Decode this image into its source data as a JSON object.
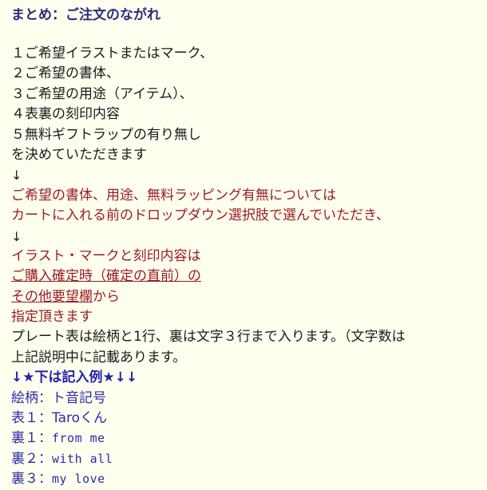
{
  "page": {
    "background_color": "#FFFFF0",
    "title_color": "#2B2B7F",
    "body_text_color": "#1A1A1A",
    "emphasis_color": "#9B1B24",
    "example_color": "#2B2BA8"
  },
  "heading": {
    "text": "まとめ：ご注文のながれ"
  },
  "steps": {
    "item_1": "１ご希望イラストまたはマーク、",
    "item_2": "２ご希望の書体、",
    "item_3": "３ご希望の用途（アイテム）、",
    "item_4": "４表裏の刻印内容",
    "item_5": "５無料ギフトラップの有り無し",
    "closing": "を決めていただきます"
  },
  "arrows": {
    "down_1": "↓",
    "down_2": "↓"
  },
  "emphasis_block_1": {
    "line_1": "ご希望の書体、用途、無料ラッピング有無については",
    "line_2": "カートに入れる前のドロップダウン選択肢で選んでいただき、"
  },
  "emphasis_block_2": {
    "line_1": "イラスト・マークと刻印内容は",
    "line_2_underlined": "ご購入確定時（確定の直前）の",
    "line_3_underlined": "その他要望欄",
    "line_3_tail": "から",
    "line_4": "指定頂きます"
  },
  "notes": {
    "line_1": "プレート表は絵柄と1行、裏は文字３行まで入ります。（文字数は",
    "line_2": "上記説明中に記載あります。"
  },
  "example_header": {
    "text": "↓★下は記入例★↓↓"
  },
  "examples": [
    {
      "label": "絵柄：",
      "value": "ト音記号",
      "value_is_ascii": false
    },
    {
      "label": "表１：",
      "value": "Taroくん",
      "value_is_ascii": false
    },
    {
      "label": "裏１：",
      "value": "from me",
      "value_is_ascii": true
    },
    {
      "label": "裏２：",
      "value": "with all",
      "value_is_ascii": true
    },
    {
      "label": "裏３：",
      "value": "my love",
      "value_is_ascii": true
    }
  ]
}
